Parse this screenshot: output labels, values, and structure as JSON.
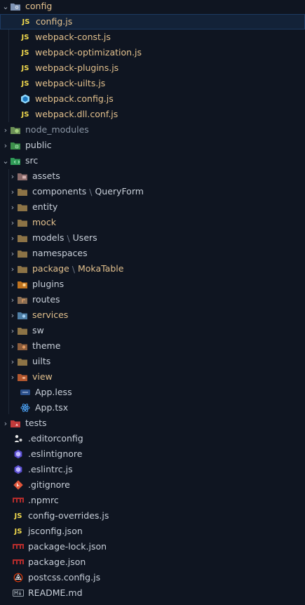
{
  "explorer": {
    "items": [
      {
        "label": "config",
        "chevron": "v",
        "icon": "folder-config-icon",
        "tone": "mod"
      },
      {
        "label": "config.js",
        "icon": "js-icon",
        "selected": true
      },
      {
        "label": "webpack-const.js",
        "icon": "js-icon"
      },
      {
        "label": "webpack-optimization.js",
        "icon": "js-icon"
      },
      {
        "label": "webpack-plugins.js",
        "icon": "js-icon"
      },
      {
        "label": "webpack-uilts.js",
        "icon": "js-icon"
      },
      {
        "label": "webpack.config.js",
        "icon": "webpack-icon",
        "tone": "mod"
      },
      {
        "label": "webpack.dll.conf.js",
        "icon": "js-icon"
      },
      {
        "label": "node_modules",
        "chevron": ">",
        "icon": "folder-node-icon",
        "tone": "dim"
      },
      {
        "label": "public",
        "chevron": ">",
        "icon": "folder-public-icon"
      },
      {
        "label": "src",
        "chevron": "v",
        "icon": "folder-src-icon"
      },
      {
        "label": "assets",
        "chevron": ">",
        "icon": "folder-assets-icon"
      },
      {
        "label": "components",
        "suffix": "QueryForm",
        "chevron": ">",
        "icon": "folder-icon"
      },
      {
        "label": "entity",
        "chevron": ">",
        "icon": "folder-icon"
      },
      {
        "label": "mock",
        "chevron": ">",
        "icon": "folder-icon",
        "tone": "mod"
      },
      {
        "label": "models",
        "suffix": "Users",
        "chevron": ">",
        "icon": "folder-icon"
      },
      {
        "label": "namespaces",
        "chevron": ">",
        "icon": "folder-icon"
      },
      {
        "label": "package",
        "suffix": "MokaTable",
        "chevron": ">",
        "icon": "folder-icon",
        "tone": "mod"
      },
      {
        "label": "plugins",
        "chevron": ">",
        "icon": "folder-plugins-icon"
      },
      {
        "label": "routes",
        "chevron": ">",
        "icon": "folder-routes-icon"
      },
      {
        "label": "services",
        "chevron": ">",
        "icon": "folder-services-icon",
        "tone": "mod"
      },
      {
        "label": "sw",
        "chevron": ">",
        "icon": "folder-icon"
      },
      {
        "label": "theme",
        "chevron": ">",
        "icon": "folder-theme-icon"
      },
      {
        "label": "uilts",
        "chevron": ">",
        "icon": "folder-icon"
      },
      {
        "label": "view",
        "chevron": ">",
        "icon": "folder-view-icon",
        "tone": "mod"
      },
      {
        "label": "App.less",
        "icon": "less-icon"
      },
      {
        "label": "App.tsx",
        "icon": "react-icon"
      },
      {
        "label": "tests",
        "chevron": ">",
        "icon": "folder-tests-icon"
      },
      {
        "label": ".editorconfig",
        "icon": "editorconfig-icon"
      },
      {
        "label": ".eslintignore",
        "icon": "eslint-icon"
      },
      {
        "label": ".eslintrc.js",
        "icon": "eslint-icon"
      },
      {
        "label": ".gitignore",
        "icon": "git-icon"
      },
      {
        "label": ".npmrc",
        "icon": "npm-icon"
      },
      {
        "label": "config-overrides.js",
        "icon": "js-icon"
      },
      {
        "label": "jsconfig.json",
        "icon": "js-icon"
      },
      {
        "label": "package-lock.json",
        "icon": "npm-icon"
      },
      {
        "label": "package.json",
        "icon": "npm-icon"
      },
      {
        "label": "postcss.config.js",
        "icon": "postcss-icon"
      },
      {
        "label": "README.md",
        "icon": "markdown-icon"
      }
    ]
  },
  "colors": {
    "background": "#0f1521",
    "selected": "#132238",
    "modified": "#e2c08d",
    "js": "#f1d94d"
  }
}
